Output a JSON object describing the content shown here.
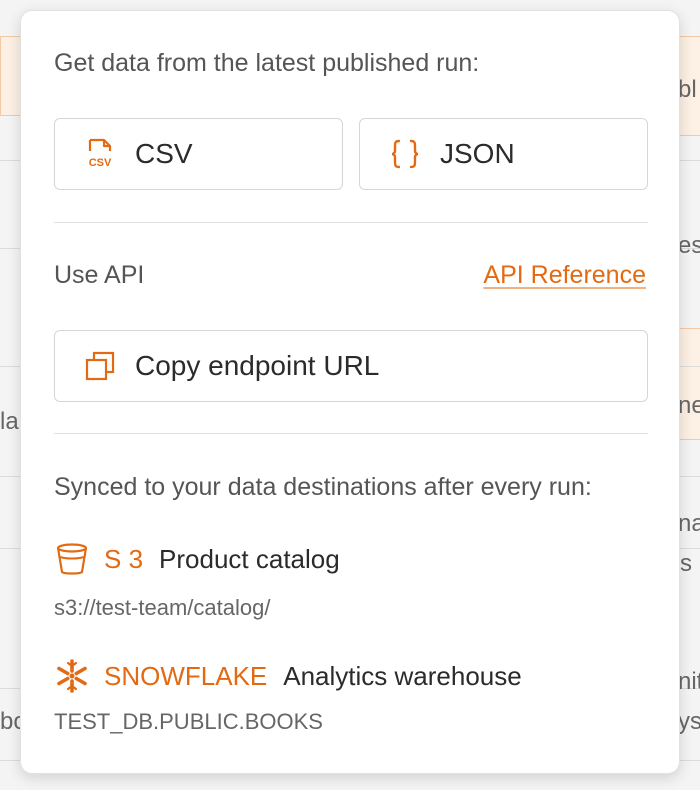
{
  "background": {
    "fragments": [
      "bl",
      "es",
      "ne",
      "la",
      "na",
      "s",
      "nit",
      "ys",
      "bo"
    ]
  },
  "download": {
    "heading": "Get data from the latest published run:",
    "csv_label": "CSV",
    "json_label": "JSON"
  },
  "api": {
    "heading": "Use API",
    "reference_link": "API Reference",
    "copy_button_label": "Copy endpoint URL"
  },
  "destinations": {
    "heading": "Synced to your data destinations after every run:",
    "items": [
      {
        "type": "S 3",
        "name": "Product catalog",
        "path": "s3://test-team/catalog/",
        "icon": "bucket-icon"
      },
      {
        "type": "SNOWFLAKE",
        "name": "Analytics warehouse",
        "path": "TEST_DB.PUBLIC.BOOKS",
        "icon": "snowflake-icon"
      }
    ]
  },
  "colors": {
    "accent": "#e36a12",
    "text": "#2b2b2b",
    "muted": "#555555",
    "border": "#d6d6d6"
  }
}
